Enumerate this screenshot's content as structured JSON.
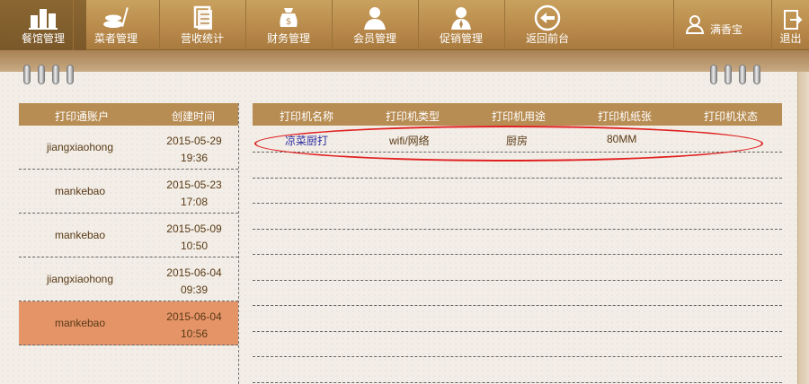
{
  "nav": {
    "items": [
      {
        "label": "餐馆管理",
        "icon": "buildings-icon",
        "active": true
      },
      {
        "label": "菜者管理",
        "icon": "dishes-icon"
      },
      {
        "label": "营收统计",
        "icon": "report-icon"
      },
      {
        "label": "财务管理",
        "icon": "money-bag-icon"
      },
      {
        "label": "会员管理",
        "icon": "member-icon"
      },
      {
        "label": "促销管理",
        "icon": "promo-icon"
      },
      {
        "label": "返回前台",
        "icon": "back-arrow-icon"
      }
    ],
    "user": {
      "name": "满香宝",
      "icon": "user-icon"
    },
    "logout_label": "退出"
  },
  "accounts_table": {
    "headers": [
      "打印通账户",
      "创建时间"
    ],
    "rows": [
      {
        "account": "jiangxiaohong",
        "date": "2015-05-29",
        "time": "19:36"
      },
      {
        "account": "mankebao",
        "date": "2015-05-23",
        "time": "17:08"
      },
      {
        "account": "mankebao",
        "date": "2015-05-09",
        "time": "10:50"
      },
      {
        "account": "jiangxiaohong",
        "date": "2015-06-04",
        "time": "09:39"
      },
      {
        "account": "mankebao",
        "date": "2015-06-04",
        "time": "10:56",
        "selected": true
      }
    ]
  },
  "printers_table": {
    "headers": [
      "打印机名称",
      "打印机类型",
      "打印机用途",
      "打印机纸张",
      "打印机状态"
    ],
    "rows": [
      {
        "name": "凉菜厨打",
        "type": "wifi/网络",
        "usage": "厨房",
        "paper": "80MM",
        "status": ""
      }
    ]
  },
  "colors": {
    "accent": "#b88d54",
    "selected_row": "#e59468",
    "highlight": "#e02020"
  }
}
